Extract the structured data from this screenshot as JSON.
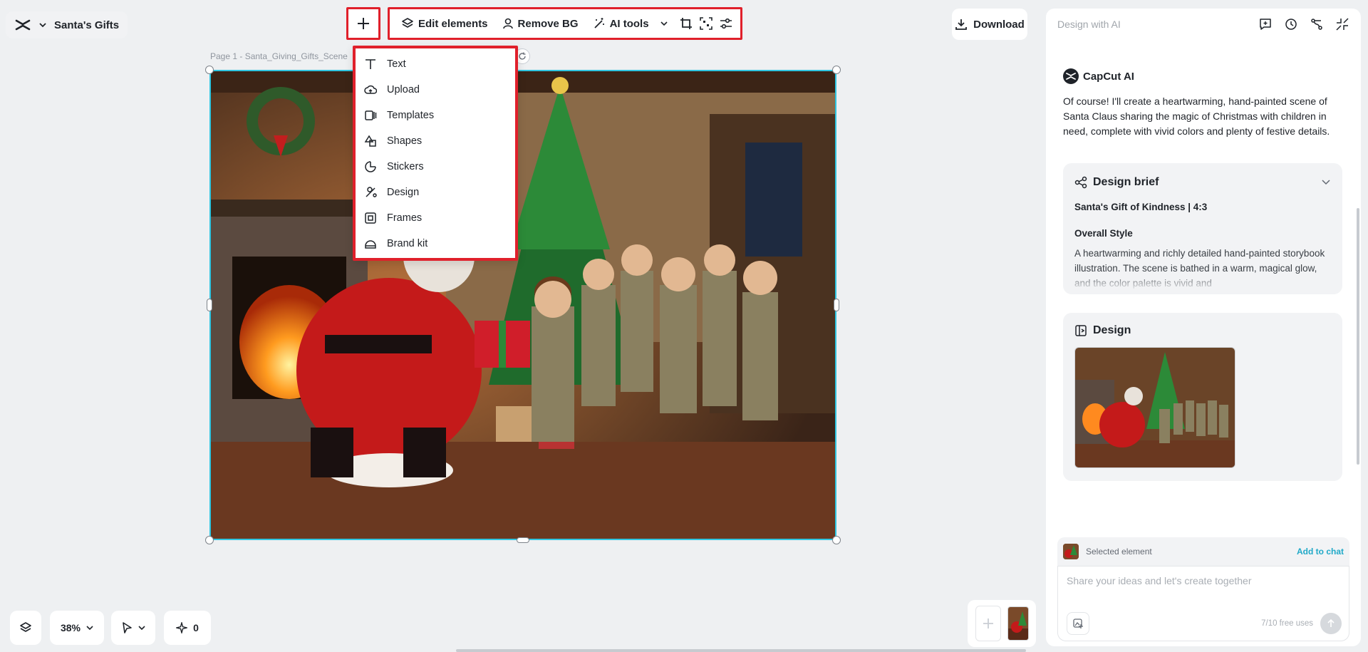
{
  "project": {
    "name": "Santa's Gifts"
  },
  "toolbar": {
    "edit_elements": "Edit elements",
    "remove_bg": "Remove BG",
    "ai_tools": "AI tools"
  },
  "download_label": "Download",
  "page_label": "Page 1 -   Santa_Giving_Gifts_Scene",
  "add_menu": {
    "items": [
      {
        "label": "Text",
        "icon": "text-icon"
      },
      {
        "label": "Upload",
        "icon": "upload-cloud-icon"
      },
      {
        "label": "Templates",
        "icon": "templates-icon"
      },
      {
        "label": "Shapes",
        "icon": "shapes-icon"
      },
      {
        "label": "Stickers",
        "icon": "sticker-icon"
      },
      {
        "label": "Design",
        "icon": "design-icon"
      },
      {
        "label": "Frames",
        "icon": "frame-icon"
      },
      {
        "label": "Brand kit",
        "icon": "brand-kit-icon"
      }
    ]
  },
  "bottom": {
    "zoom": "38%",
    "credits": "0"
  },
  "panel": {
    "title": "Design with AI",
    "assistant_name": "CapCut AI",
    "message": "Of course! I'll create a heartwarming, hand-painted scene of Santa Claus sharing the magic of Christmas with children in need, complete with vivid colors and plenty of festive details.",
    "brief": {
      "title": "Design brief",
      "subtitle": "Santa's Gift of Kindness | 4:3",
      "section": "Overall Style",
      "text": "A heartwarming and richly detailed hand-painted storybook illustration. The scene is bathed in a warm, magical glow, and the color palette is vivid and"
    },
    "design": {
      "title": "Design"
    },
    "selected_label": "Selected element",
    "add_to_chat": "Add to chat",
    "input_placeholder": "Share your ideas and let's create together",
    "free_uses": "7/10 free uses"
  },
  "colors": {
    "accent": "#2fc5e0",
    "highlight": "#e0202b"
  }
}
